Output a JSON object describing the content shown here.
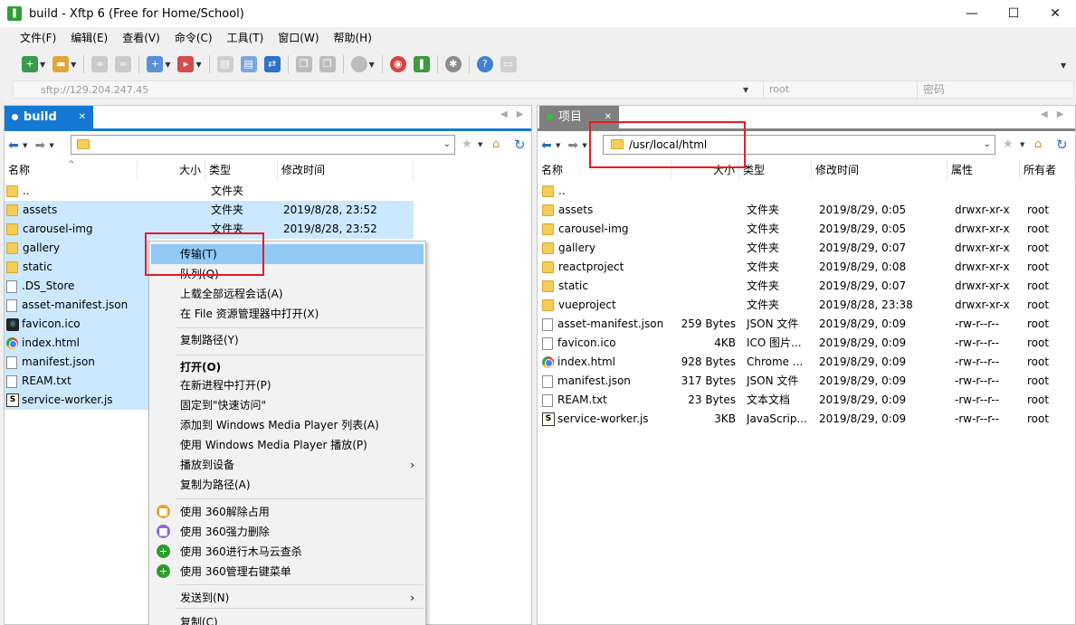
{
  "window": {
    "title": "build - Xftp 6 (Free for Home/School)",
    "app_icon": "xftp-icon",
    "controls": [
      "minimize",
      "maximize",
      "close"
    ]
  },
  "menu": [
    "文件(F)",
    "编辑(E)",
    "查看(V)",
    "命令(C)",
    "工具(T)",
    "窗口(W)",
    "帮助(H)"
  ],
  "address": {
    "host": "sftp://129.204.247.45",
    "user_placeholder": "root",
    "password_placeholder": "密码"
  },
  "left": {
    "tab": "build",
    "path": "",
    "columns": [
      "名称",
      "大小",
      "类型",
      "修改时间"
    ],
    "rows": [
      {
        "name": "..",
        "size": "",
        "type": "文件夹",
        "modified": "",
        "icon": "folder",
        "selected": false
      },
      {
        "name": "assets",
        "size": "",
        "type": "文件夹",
        "modified": "2019/8/28, 23:52",
        "icon": "folder",
        "selected": true
      },
      {
        "name": "carousel-img",
        "size": "",
        "type": "文件夹",
        "modified": "2019/8/28, 23:52",
        "icon": "folder",
        "selected": true
      },
      {
        "name": "gallery",
        "size": "",
        "type": "",
        "modified": "",
        "icon": "folder",
        "selected": true
      },
      {
        "name": "static",
        "size": "",
        "type": "",
        "modified": "",
        "icon": "folder",
        "selected": true
      },
      {
        "name": ".DS_Store",
        "size": "",
        "type": "",
        "modified": "",
        "icon": "file",
        "selected": true
      },
      {
        "name": "asset-manifest.json",
        "size": "",
        "type": "",
        "modified": "",
        "icon": "file",
        "selected": true
      },
      {
        "name": "favicon.ico",
        "size": "",
        "type": "",
        "modified": "",
        "icon": "react",
        "selected": true
      },
      {
        "name": "index.html",
        "size": "",
        "type": "",
        "modified": "",
        "icon": "chrome",
        "selected": true
      },
      {
        "name": "manifest.json",
        "size": "",
        "type": "",
        "modified": "",
        "icon": "file",
        "selected": true
      },
      {
        "name": "REAM.txt",
        "size": "",
        "type": "",
        "modified": "",
        "icon": "file",
        "selected": true
      },
      {
        "name": "service-worker.js",
        "size": "",
        "type": "",
        "modified": "",
        "icon": "js",
        "selected": true
      }
    ]
  },
  "right": {
    "tab": "项目",
    "path": "/usr/local/html",
    "columns": [
      "名称",
      "大小",
      "类型",
      "修改时间",
      "属性",
      "所有者"
    ],
    "rows": [
      {
        "name": "..",
        "size": "",
        "type": "",
        "modified": "",
        "attr": "",
        "owner": "",
        "icon": "folder"
      },
      {
        "name": "assets",
        "size": "",
        "type": "文件夹",
        "modified": "2019/8/29, 0:05",
        "attr": "drwxr-xr-x",
        "owner": "root",
        "icon": "folder"
      },
      {
        "name": "carousel-img",
        "size": "",
        "type": "文件夹",
        "modified": "2019/8/29, 0:05",
        "attr": "drwxr-xr-x",
        "owner": "root",
        "icon": "folder"
      },
      {
        "name": "gallery",
        "size": "",
        "type": "文件夹",
        "modified": "2019/8/29, 0:07",
        "attr": "drwxr-xr-x",
        "owner": "root",
        "icon": "folder"
      },
      {
        "name": "reactproject",
        "size": "",
        "type": "文件夹",
        "modified": "2019/8/29, 0:08",
        "attr": "drwxr-xr-x",
        "owner": "root",
        "icon": "folder"
      },
      {
        "name": "static",
        "size": "",
        "type": "文件夹",
        "modified": "2019/8/29, 0:07",
        "attr": "drwxr-xr-x",
        "owner": "root",
        "icon": "folder"
      },
      {
        "name": "vueproject",
        "size": "",
        "type": "文件夹",
        "modified": "2019/8/28, 23:38",
        "attr": "drwxr-xr-x",
        "owner": "root",
        "icon": "folder"
      },
      {
        "name": "asset-manifest.json",
        "size": "259 Bytes",
        "type": "JSON 文件",
        "modified": "2019/8/29, 0:09",
        "attr": "-rw-r--r--",
        "owner": "root",
        "icon": "file"
      },
      {
        "name": "favicon.ico",
        "size": "4KB",
        "type": "ICO 图片...",
        "modified": "2019/8/29, 0:09",
        "attr": "-rw-r--r--",
        "owner": "root",
        "icon": "file"
      },
      {
        "name": "index.html",
        "size": "928 Bytes",
        "type": "Chrome ...",
        "modified": "2019/8/29, 0:09",
        "attr": "-rw-r--r--",
        "owner": "root",
        "icon": "chrome"
      },
      {
        "name": "manifest.json",
        "size": "317 Bytes",
        "type": "JSON 文件",
        "modified": "2019/8/29, 0:09",
        "attr": "-rw-r--r--",
        "owner": "root",
        "icon": "file"
      },
      {
        "name": "REAM.txt",
        "size": "23 Bytes",
        "type": "文本文档",
        "modified": "2019/8/29, 0:09",
        "attr": "-rw-r--r--",
        "owner": "root",
        "icon": "file"
      },
      {
        "name": "service-worker.js",
        "size": "3KB",
        "type": "JavaScrip...",
        "modified": "2019/8/29, 0:09",
        "attr": "-rw-r--r--",
        "owner": "root",
        "icon": "js"
      }
    ]
  },
  "context_menu": [
    {
      "label": "传输(T)",
      "highlighted": true
    },
    {
      "label": "队列(Q)"
    },
    {
      "label": "上载全部远程会话(A)"
    },
    {
      "label": "在 File 资源管理器中打开(X)"
    },
    {
      "label": "复制路径(Y)"
    },
    {
      "label": "打开(O)",
      "bold": true
    },
    {
      "label": "在新进程中打开(P)"
    },
    {
      "label": "固定到\"快速访问\""
    },
    {
      "label": "添加到 Windows Media Player 列表(A)"
    },
    {
      "label": "使用 Windows Media Player 播放(P)"
    },
    {
      "label": "播放到设备",
      "submenu": true
    },
    {
      "label": "复制为路径(A)"
    },
    {
      "label": "使用 360解除占用"
    },
    {
      "label": "使用 360强力删除"
    },
    {
      "label": "使用 360进行木马云查杀"
    },
    {
      "label": "使用 360管理右键菜单"
    },
    {
      "label": "发送到(N)",
      "submenu": true
    },
    {
      "label": "复制(C)"
    }
  ],
  "colors": {
    "accent": "#1578d3",
    "selection": "#cce8ff",
    "menu_highlight": "#91c9f7",
    "annotation": "#e51c23"
  }
}
